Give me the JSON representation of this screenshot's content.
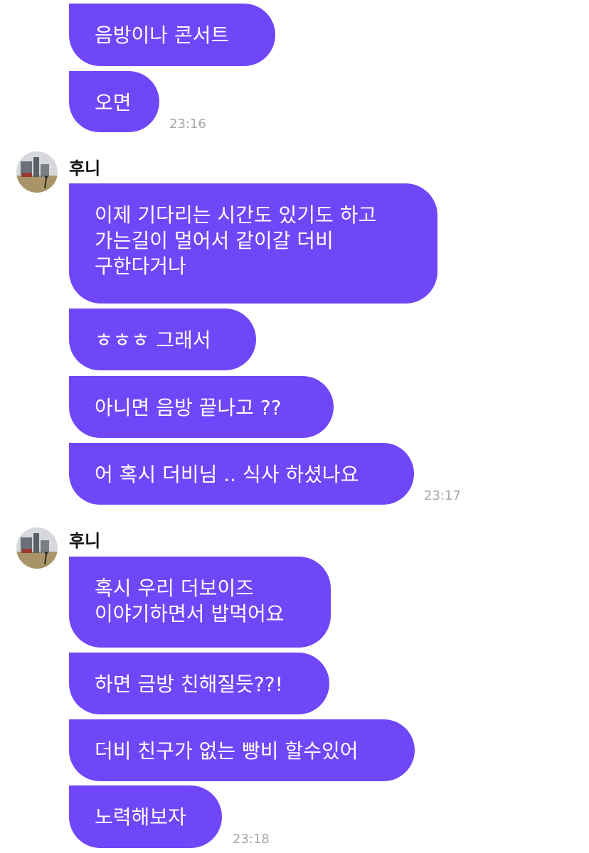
{
  "groups": [
    {
      "messages": [
        {
          "lines": [
            "음방이나 콘서트"
          ]
        },
        {
          "lines": [
            "오면"
          ]
        }
      ],
      "time": "23:16"
    },
    {
      "sender": "후니",
      "avatar_icon": "profile-photo-avatar",
      "messages": [
        {
          "lines": [
            "이제 기다리는 시간도 있기도 하고",
            "가는길이 멀어서 같이갈 더비",
            "구한다거나"
          ]
        },
        {
          "lines": [
            "ㅎㅎㅎ 그래서"
          ]
        },
        {
          "lines": [
            "아니면 음방 끝나고 ??"
          ]
        },
        {
          "lines": [
            "어 혹시 더비님 .. 식사 하셨나요"
          ]
        }
      ],
      "time": "23:17"
    },
    {
      "sender": "후니",
      "avatar_icon": "profile-photo-avatar",
      "messages": [
        {
          "lines": [
            "혹시 우리 더보이즈",
            "이야기하면서 밥먹어요"
          ]
        },
        {
          "lines": [
            "하면 금방 친해질듯??!"
          ]
        },
        {
          "lines": [
            "더비 친구가 없는 빵비 할수있어"
          ]
        },
        {
          "lines": [
            "노력해보자"
          ]
        }
      ],
      "time": "23:18"
    }
  ],
  "colors": {
    "bubble": "#7047f8",
    "bubble_text": "#ffffff",
    "timestamp": "#a8a8a8",
    "background": "#ffffff"
  }
}
